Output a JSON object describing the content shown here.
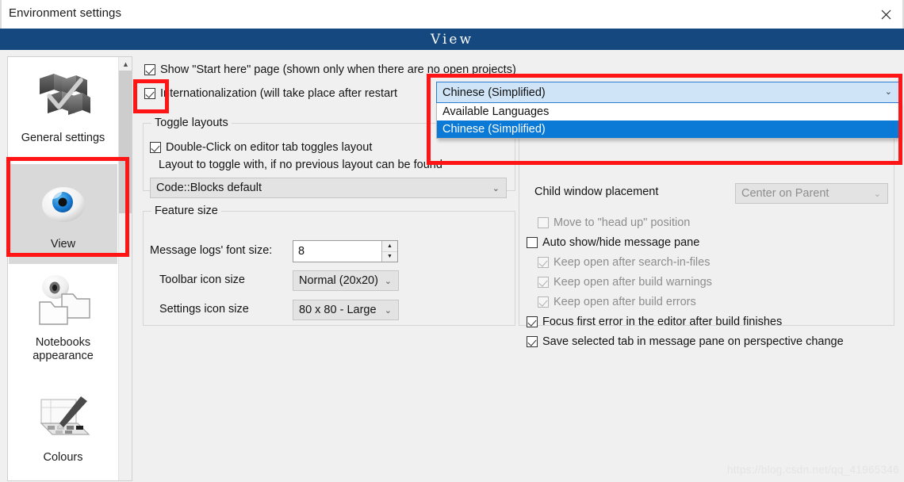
{
  "window": {
    "title": "Environment settings",
    "close_icon": "close-icon"
  },
  "page_header": {
    "text": "View"
  },
  "sidebar": {
    "scroll_up_icon": "chevron-up-icon",
    "items": [
      {
        "label": "General settings",
        "icon": "blocks-check-icon",
        "selected": false
      },
      {
        "label": "View",
        "icon": "eye-icon",
        "selected": true
      },
      {
        "label": "Notebooks appearance",
        "icon": "notebooks-icon",
        "selected": false
      },
      {
        "label": "Colours",
        "icon": "palette-brush-icon",
        "selected": false
      }
    ]
  },
  "main": {
    "show_start_here": {
      "label": "Show \"Start here\" page (shown only when there are no open projects)",
      "checked": true
    },
    "internationalization": {
      "label": "Internationalization (will take place after restart",
      "checked": true
    },
    "language_dropdown": {
      "value": "Chinese (Simplified)",
      "arrow_icon": "chevron-down-icon",
      "options": [
        {
          "label": "Available Languages",
          "selected": false
        },
        {
          "label": "Chinese (Simplified)",
          "selected": true
        }
      ]
    },
    "toggle_layouts": {
      "title": "Toggle layouts",
      "double_click": {
        "label": "Double-Click on editor tab toggles layout",
        "checked": true
      },
      "layout_hint": "Layout to toggle with, if no previous layout can be found",
      "layout_combo": {
        "value": "Code::Blocks default",
        "arrow_icon": "chevron-down-icon"
      }
    },
    "feature_size": {
      "title": "Feature size",
      "message_logs_label": "Message logs' font size:",
      "message_logs_value": "8",
      "spin_up_icon": "triangle-up-icon",
      "spin_down_icon": "triangle-down-icon",
      "toolbar_icon_label": "Toolbar icon size",
      "toolbar_icon_value": "Normal (20x20)",
      "settings_icon_label": "Settings icon size",
      "settings_icon_value": "80 x 80 - Large",
      "arrow_icon": "chevron-down-icon"
    },
    "right_panel": {
      "child_window_label": "Child window placement",
      "child_window_value": "Center on Parent",
      "arrow_icon": "chevron-down-icon",
      "checkboxes": [
        {
          "label": "Move to \"head up\" position",
          "checked": false,
          "enabled": false
        },
        {
          "label": "Auto show/hide message pane",
          "checked": false,
          "enabled": true
        },
        {
          "label": "Keep open after search-in-files",
          "checked": true,
          "enabled": false
        },
        {
          "label": "Keep open after build warnings",
          "checked": true,
          "enabled": false
        },
        {
          "label": "Keep open after build errors",
          "checked": true,
          "enabled": false
        },
        {
          "label": "Focus first error in the editor after build finishes",
          "checked": true,
          "enabled": true
        },
        {
          "label": "Save selected tab in message pane on perspective change",
          "checked": true,
          "enabled": true
        }
      ]
    }
  },
  "annotations": {
    "color": "#ff1515",
    "boxes": [
      {
        "name": "view-sidebar-highlight"
      },
      {
        "name": "internationalization-checkbox-highlight"
      },
      {
        "name": "language-dropdown-highlight"
      }
    ]
  },
  "watermark": {
    "text": "https://blog.csdn.net/qq_41965346"
  }
}
